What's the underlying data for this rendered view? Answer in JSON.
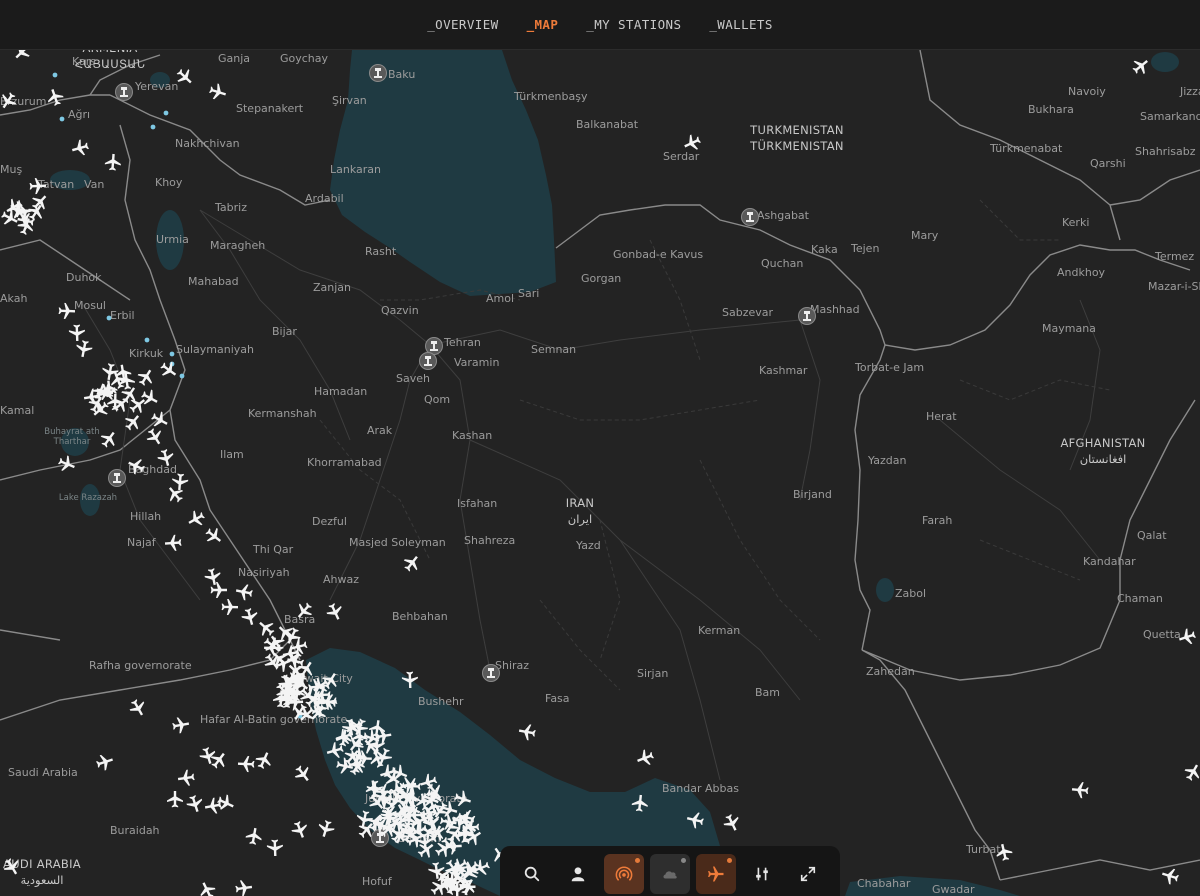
{
  "nav": {
    "items": [
      {
        "label": "_OVERVIEW",
        "active": false
      },
      {
        "label": "_MAP",
        "active": true
      },
      {
        "label": "_MY STATIONS",
        "active": false
      },
      {
        "label": "_WALLETS",
        "active": false
      }
    ]
  },
  "map": {
    "countries": [
      {
        "name": "IRAN",
        "native": "ایران"
      },
      {
        "name": "AFGHANISTAN",
        "native": "افغانستان"
      },
      {
        "name": "TURKMENISTAN",
        "native": "TÜRKMENISTAN"
      },
      {
        "name": "AUDI ARABIA",
        "native": "السعودية"
      },
      {
        "name": "ARMENIA",
        "native": "ՀԱՅԱՍՏԱՆ"
      }
    ],
    "cities": [
      "Kars",
      "Ganja",
      "Goychay",
      "Baku",
      "Yerevan",
      "Ağrı",
      "Şirvan",
      "Türkmenbaşy",
      "Navoiy",
      "Jizza",
      "Erzurum",
      "Stepanakert",
      "Balkanabat",
      "Bukhara",
      "Samarkand",
      "Nakhchivan",
      "Serdar",
      "Türkmenabat",
      "Qarshi",
      "Shahrisabz",
      "Muş",
      "Van",
      "Khoy",
      "Lankaran",
      "Tatvan",
      "Tabriz",
      "Ardabil",
      "Ashgabat",
      "Kerki",
      "Urmia",
      "Maragheh",
      "Rasht",
      "Gonbad-e Kavus",
      "Kaka",
      "Tejen",
      "Mary",
      "Quchan",
      "Duhok",
      "Termez",
      "Mahabad",
      "Zanjan",
      "Gorgan",
      "Andkhoy",
      "Mazar-i-Sh",
      "Sari",
      "Amol",
      "Akah",
      "Mosul",
      "Erbil",
      "Qazvin",
      "Sabzevar",
      "Mashhad",
      "Maymana",
      "Bijar",
      "Tehran",
      "Kirkuk",
      "Sulaymaniyah",
      "Semnan",
      "Saveh",
      "Varamin",
      "Kashmar",
      "Torbat-e Jam",
      "Hamadan",
      "Qom",
      "Kamal",
      "Kermanshah",
      "Herat",
      "Arak",
      "Kashan",
      "Ilam",
      "Baghdad",
      "Khorramabad",
      "Yazdan",
      "Hillah",
      "Isfahan",
      "Birjand",
      "Farah",
      "Najaf",
      "Dezful",
      "Masjed Soleyman",
      "Shahreza",
      "Yazd",
      "Qalat",
      "Thi Qar",
      "Ahwaz",
      "Kandahar",
      "Nasiriyah",
      "Zabol",
      "Behbahan",
      "Chaman",
      "Basra",
      "Kerman",
      "Quetta",
      "Rafha governorate",
      "Shiraz",
      "Kuwait City",
      "Sirjan",
      "Zahedan",
      "Hafar Al-Batin governorate",
      "Bushehr",
      "Fasa",
      "Bam",
      "Saudi Arabia",
      "Bandar Abbas",
      "Jubail Governorate",
      "Buraidah",
      "Turbat",
      "Hofuf",
      "Chabahar",
      "Gwadar",
      "Bahrain"
    ],
    "water": [
      "Buhayrat ath Tharthar",
      "Lake Razazah"
    ]
  },
  "toolbar": {
    "buttons": [
      {
        "icon": "search-icon"
      },
      {
        "icon": "user-icon"
      },
      {
        "icon": "broadcast-icon",
        "active": true,
        "badge": "#e47a3a"
      },
      {
        "icon": "cloud-icon",
        "muted": true,
        "badge": "#888888"
      },
      {
        "icon": "airplane-icon",
        "active": true,
        "badge": "#e47a3a"
      },
      {
        "icon": "sliders-icon"
      },
      {
        "icon": "expand-icon"
      }
    ]
  },
  "colors": {
    "land": "#232323",
    "water": "#1f3a42",
    "border": "#8e8e8e",
    "accent": "#ee7b3a",
    "plane": "#f4f4f4",
    "station": "#7ec8e3"
  }
}
